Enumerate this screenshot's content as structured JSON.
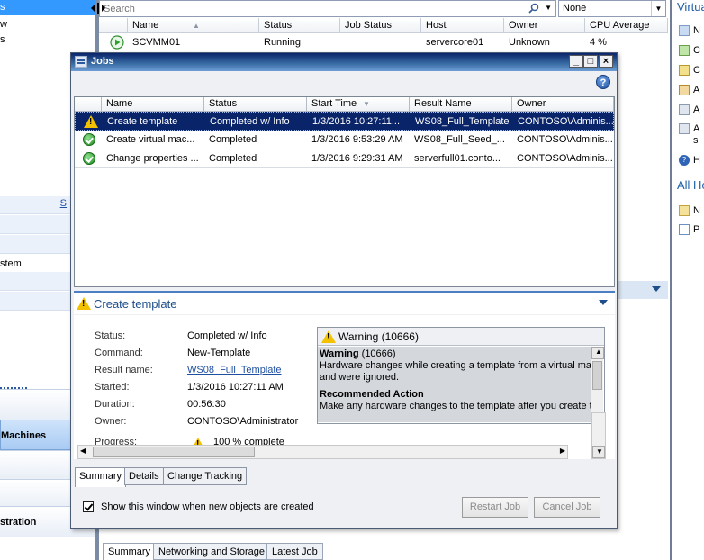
{
  "background": {
    "left_items": {
      "top_selected": "s",
      "row2": "w",
      "row3": "s",
      "system_fragment": "stem",
      "vm_button": "Machines",
      "admin_button": "stration",
      "link_fragment": "S"
    },
    "search": {
      "placeholder": "Search"
    },
    "filter": {
      "value": "None"
    },
    "vm_columns": [
      "Name",
      "Status",
      "Job Status",
      "Host",
      "Owner",
      "CPU Average"
    ],
    "vm_row": {
      "name": "SCVMM01",
      "status": "Running",
      "job_status": "",
      "host": "servercore01",
      "owner": "Unknown",
      "cpu": "4 %"
    },
    "right_pane": {
      "title": "Virtua",
      "items": [
        "N",
        "C",
        "C",
        "A",
        "A",
        "A",
        "s",
        "H"
      ],
      "section": "All Ho",
      "items2": [
        "N",
        "P"
      ]
    },
    "tabs": [
      "Summary",
      "Networking and Storage",
      "Latest Job"
    ]
  },
  "jobs_window": {
    "title": "Jobs",
    "title_buttons": {
      "minimize": "_",
      "maximize": "□",
      "close": "×"
    },
    "help": "?",
    "columns": [
      "Name",
      "Status",
      "Start Time",
      "Result Name",
      "Owner"
    ],
    "rows": [
      {
        "icon": "warning-icon",
        "name": "Create template",
        "status": "Completed w/ Info",
        "start_time": "1/3/2016 10:27:11...",
        "result_name": "WS08_Full_Template",
        "owner": "CONTOSO\\Adminis..."
      },
      {
        "icon": "ok-icon",
        "name": "Create virtual mac...",
        "status": "Completed",
        "start_time": "1/3/2016 9:53:29 AM",
        "result_name": "WS08_Full_Seed_...",
        "owner": "CONTOSO\\Adminis..."
      },
      {
        "icon": "ok-icon",
        "name": "Change properties ...",
        "status": "Completed",
        "start_time": "1/3/2016 9:29:31 AM",
        "result_name": "serverfull01.conto...",
        "owner": "CONTOSO\\Adminis..."
      }
    ],
    "detail": {
      "title": "Create template",
      "props": [
        {
          "label": "Status:",
          "value": "Completed w/ Info"
        },
        {
          "label": "Command:",
          "value": "New-Template"
        },
        {
          "label": "Result name:",
          "value": "WS08_Full_Template"
        },
        {
          "label": "Started:",
          "value": "1/3/2016 10:27:11 AM"
        },
        {
          "label": "Duration:",
          "value": "00:56:30"
        },
        {
          "label": "Owner:",
          "value": "CONTOSO\\Administrator"
        },
        {
          "label": "Progress:",
          "value": "100 % complete"
        }
      ],
      "warning": {
        "header": "Warning (10666)",
        "bold_title": "Warning",
        "code": " (10666)",
        "line1": "Hardware changes while creating a template from a virtual mach",
        "line2": "and were ignored.",
        "rec_title": "Recommended Action",
        "rec_text": "Make any hardware changes to the template after you create th"
      },
      "tabs": [
        "Summary",
        "Details",
        "Change Tracking"
      ]
    },
    "show_checkbox_label": "Show this window when new objects are created",
    "buttons": {
      "restart": "Restart Job",
      "cancel": "Cancel Job"
    }
  }
}
